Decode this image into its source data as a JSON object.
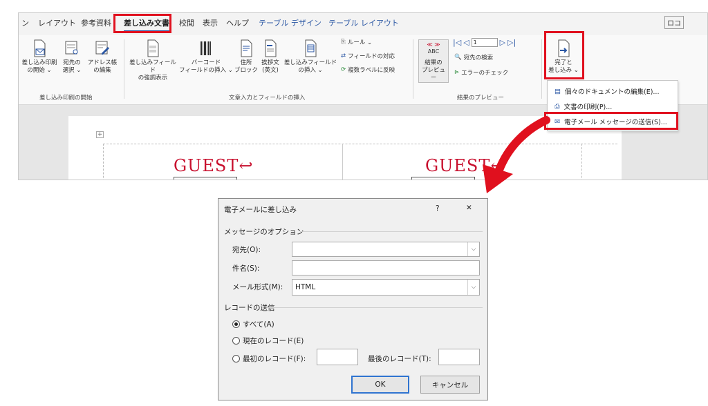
{
  "ribbon": {
    "tabs": [
      "ン",
      "レイアウト",
      "参考資料",
      "差し込み文書",
      "校閲",
      "表示",
      "ヘルプ",
      "テーブル デザイン",
      "テーブル レイアウト"
    ],
    "right_tab_stub": "ロコ",
    "groups": {
      "start": {
        "label": "差し込み印刷の開始",
        "buttons": [
          {
            "line1": "差し込み印刷",
            "line2": "の開始 ⌄"
          },
          {
            "line1": "宛先の",
            "line2": "選択 ⌄"
          },
          {
            "line1": "アドレス帳",
            "line2": "の編集"
          }
        ]
      },
      "write": {
        "label": "文章入力とフィールドの挿入",
        "buttons": [
          {
            "line1": "差し込みフィールド",
            "line2": "の強調表示"
          },
          {
            "line1": "バーコード",
            "line2": "フィールドの挿入 ⌄"
          },
          {
            "line1": "住所",
            "line2": "ブロック"
          },
          {
            "line1": "挨拶文",
            "line2": "(英文)"
          },
          {
            "line1": "差し込みフィールド",
            "line2": "の挿入 ⌄"
          }
        ],
        "small": [
          "ルール ⌄",
          "フィールドの対応",
          "複数ラベルに反映"
        ]
      },
      "preview": {
        "label": "結果のプレビュー",
        "button": {
          "line1": "結果の",
          "line2": "プレビュー"
        },
        "abc": "ABC",
        "record_value": "1",
        "small": [
          "宛先の検索",
          "エラーのチェック"
        ]
      },
      "finish": {
        "line1": "完了と",
        "line2": "差し込み ⌄"
      }
    },
    "menu": {
      "items": [
        "個々のドキュメントの編集(E)...",
        "文書の印刷(P)...",
        "電子メール メッセージの送信(S)..."
      ]
    },
    "document": {
      "cells": [
        "GUEST↩",
        "GUEST↩"
      ]
    }
  },
  "dialog": {
    "title": "電子メールに差し込み",
    "help": "?",
    "close": "✕",
    "section_message": "メッセージのオプション",
    "to_label": "宛先(O):",
    "to_value": "",
    "subject_label": "件名(S):",
    "subject_value": "",
    "format_label": "メール形式(M):",
    "format_value": "HTML",
    "section_records": "レコードの送信",
    "radio_all": "すべて(A)",
    "radio_current": "現在のレコード(E)",
    "radio_from": "最初のレコード(F):",
    "to_record_label": "最後のレコード(T):",
    "from_value": "",
    "to_value_record": "",
    "ok": "OK",
    "cancel": "キャンセル"
  },
  "colors": {
    "highlight_red": "#e0101e",
    "accent_blue": "#2b57a4",
    "guest_red": "#c8102e"
  }
}
